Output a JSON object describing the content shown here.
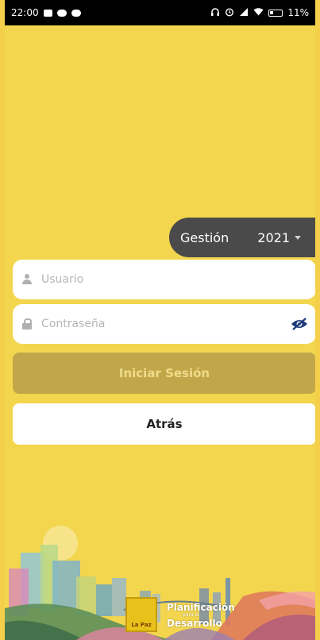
{
  "status_bar": {
    "time": "22:00",
    "battery": "11%"
  },
  "gestion": {
    "label": "Gestión",
    "year": "2021"
  },
  "login": {
    "username_placeholder": "Usuario",
    "password_placeholder": "Contraseña",
    "login_label": "Iniciar Sesión",
    "back_label": "Atrás"
  },
  "footer": {
    "logo_city": "La Paz",
    "logo_line1": "Planificación",
    "logo_line2": "para el",
    "logo_line3": "Desarrollo"
  },
  "colors": {
    "background": "#f3d64e",
    "pill": "#4a4a4a",
    "login_button": "#c2a64a",
    "eye_icon": "#1e3a7b"
  }
}
